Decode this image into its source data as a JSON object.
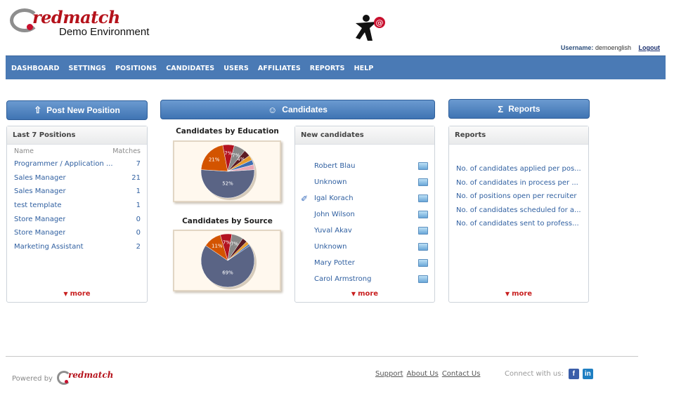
{
  "header": {
    "logo_text": "redmatch",
    "logo_subtitle": "Demo Environment",
    "center_icon": "user-at-icon"
  },
  "userbar": {
    "username_label": "Username:",
    "username": "demoenglish",
    "logout_label": "Logout"
  },
  "nav": {
    "items": [
      "DASHBOARD",
      "SETTINGS",
      "POSITIONS",
      "CANDIDATES",
      "USERS",
      "AFFILIATES",
      "REPORTS",
      "HELP"
    ]
  },
  "buttons": {
    "post_position": "Post New Position",
    "candidates": "Candidates",
    "reports": "Reports"
  },
  "positions_panel": {
    "title": "Last 7 Positions",
    "col_name": "Name",
    "col_matches": "Matches",
    "rows": [
      {
        "name": "Programmer / Application ...",
        "matches": "7"
      },
      {
        "name": "Sales Manager",
        "matches": "21"
      },
      {
        "name": "Sales Manager",
        "matches": "1"
      },
      {
        "name": "test template",
        "matches": "1"
      },
      {
        "name": "Store Manager",
        "matches": "0"
      },
      {
        "name": "Store Manager",
        "matches": "0"
      },
      {
        "name": "Marketing Assistant",
        "matches": "2"
      }
    ],
    "more": "more"
  },
  "charts": {
    "education_title": "Candidates by Education",
    "source_title": "Candidates by Source"
  },
  "chart_data": [
    {
      "type": "pie",
      "title": "Candidates by Education",
      "slices": [
        {
          "value": 52,
          "label": "52%",
          "color": "#5a6485"
        },
        {
          "value": 21,
          "label": "21%",
          "color": "#d35400"
        },
        {
          "value": 7,
          "label": "7%",
          "color": "#b3121f"
        },
        {
          "value": 7,
          "label": "7%",
          "color": "#888888"
        },
        {
          "value": 4,
          "label": "4%",
          "color": "#5c1b24"
        },
        {
          "value": 3,
          "label": "",
          "color": "#e59b2f"
        },
        {
          "value": 3,
          "label": "",
          "color": "#3d6db2"
        },
        {
          "value": 3,
          "label": "",
          "color": "#e8a6b5"
        }
      ]
    },
    {
      "type": "pie",
      "title": "Candidates by Source",
      "slices": [
        {
          "value": 69,
          "label": "69%",
          "color": "#5a6485"
        },
        {
          "value": 11,
          "label": "11%",
          "color": "#d35400"
        },
        {
          "value": 7,
          "label": "7%",
          "color": "#b3121f"
        },
        {
          "value": 7,
          "label": "7%",
          "color": "#888888"
        },
        {
          "value": 3,
          "label": "",
          "color": "#5c1b24"
        },
        {
          "value": 2,
          "label": "",
          "color": "#e59b2f"
        },
        {
          "value": 1,
          "label": "",
          "color": "#3d6db2"
        }
      ]
    }
  ],
  "candidates_panel": {
    "title": "New candidates",
    "rows": [
      {
        "name": "Robert Blau",
        "tagged": false
      },
      {
        "name": "Unknown",
        "tagged": false
      },
      {
        "name": "Igal Korach",
        "tagged": true
      },
      {
        "name": "John Wilson",
        "tagged": false
      },
      {
        "name": "Yuval Akav",
        "tagged": false
      },
      {
        "name": "Unknown",
        "tagged": false
      },
      {
        "name": "Mary Potter",
        "tagged": false
      },
      {
        "name": "Carol Armstrong",
        "tagged": false
      }
    ],
    "more": "more"
  },
  "reports_panel": {
    "title": "Reports",
    "items": [
      "No. of candidates applied per pos...",
      "No. of candidates in process per ...",
      "No. of positions open per recruiter",
      "No. of candidates scheduled for a...",
      "No. of candidates sent to profess..."
    ],
    "more": "more"
  },
  "footer": {
    "powered_by": "Powered by",
    "logo_text": "redmatch",
    "links": [
      "Support",
      "About Us",
      "Contact Us"
    ],
    "connect": "Connect with us:",
    "facebook": "f",
    "linkedin": "in"
  },
  "colors": {
    "nav_bg": "#4a7ab5",
    "link": "#2f5fa0",
    "more": "#c81f1f",
    "brand_red": "#b5121b"
  }
}
